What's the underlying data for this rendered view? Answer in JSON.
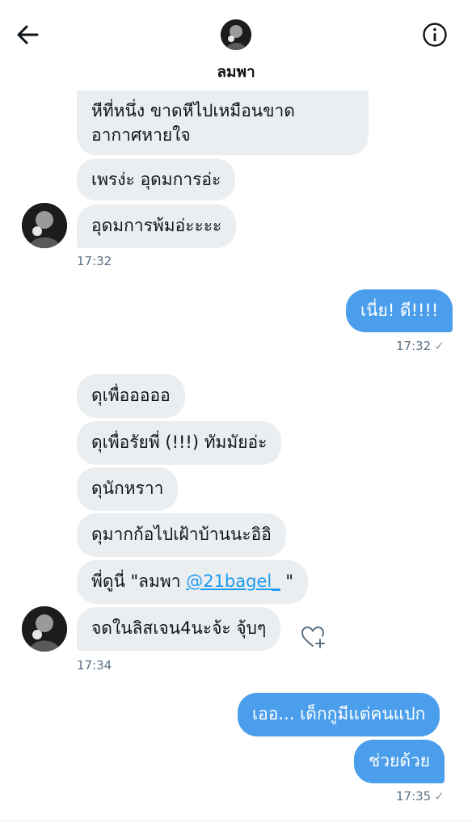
{
  "header": {
    "title": "ลมพา",
    "back_icon": "arrow-left-icon",
    "info_icon": "info-circle-icon"
  },
  "messages": {
    "m1": "หีที่หนึ่ง ขาดหีไปเหมือนขาด",
    "m1b": "อากาศหายใจ",
    "m2": "เพรง่ะ อุดมการอ่ะ",
    "m3": "อุดมการพ้มอ่ะะะะ",
    "t1": "17:32",
    "m4": "เนี่ย! ดี!!!!",
    "t2": "17:32",
    "m5": "ดุเพื่อออออ",
    "m6": "ดุเพื่อรัยพี่ (!!!) ทัมมัยอ่ะ",
    "m7": "ดุนักหราา",
    "m8": "ดุมากก้อไปเฝ้าบ้านนะอิอิ",
    "m9_prefix": "พี่ดูนี่ \"ลมพา ",
    "m9_mention": "@21bagel_",
    "m9_suffix": " \"",
    "m10": "จดในลิสเจน4นะจ้ะ จุ้บๆ",
    "t3": "17:34",
    "m11": "เออ... เด็กกูมีแต่คนแปก",
    "m12": "ช่วยด้วย",
    "t4": "17:35",
    "check": "✓"
  },
  "colors": {
    "outgoing_bubble": "#4a9eeb",
    "incoming_bubble": "#ebeef0",
    "mention": "#1d9bf0",
    "timestamp": "#5b7083"
  },
  "icons": {
    "react": "heart-plus-icon"
  }
}
